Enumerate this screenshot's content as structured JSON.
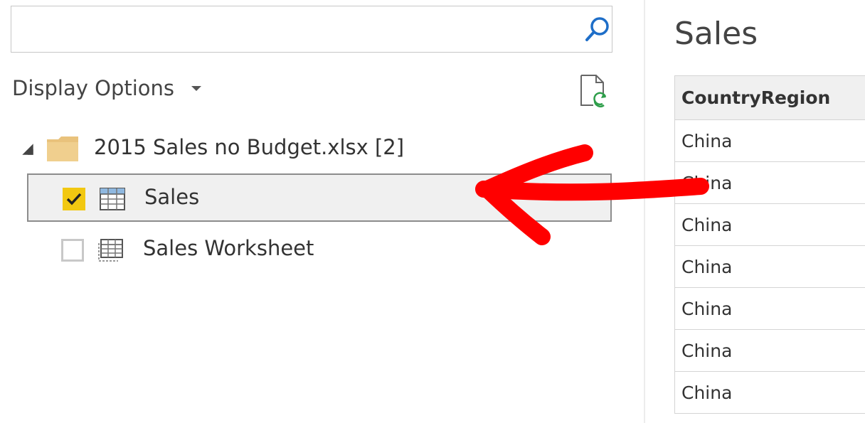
{
  "search": {
    "value": "",
    "placeholder": ""
  },
  "toolbar": {
    "display_options_label": "Display Options"
  },
  "tree": {
    "file_label": "2015 Sales no Budget.xlsx [2]",
    "items": [
      {
        "label": "Sales",
        "checked": true,
        "selected": true
      },
      {
        "label": "Sales Worksheet",
        "checked": false,
        "selected": false
      }
    ]
  },
  "preview": {
    "title": "Sales",
    "columns": [
      "CountryRegion"
    ],
    "rows": [
      "China",
      "China",
      "China",
      "China",
      "China",
      "China",
      "China"
    ]
  },
  "colors": {
    "checkbox_checked": "#f2c811",
    "annotation_arrow": "#ff0000",
    "selection_background": "#f0f0f0",
    "search_icon": "#1e6ec8"
  }
}
